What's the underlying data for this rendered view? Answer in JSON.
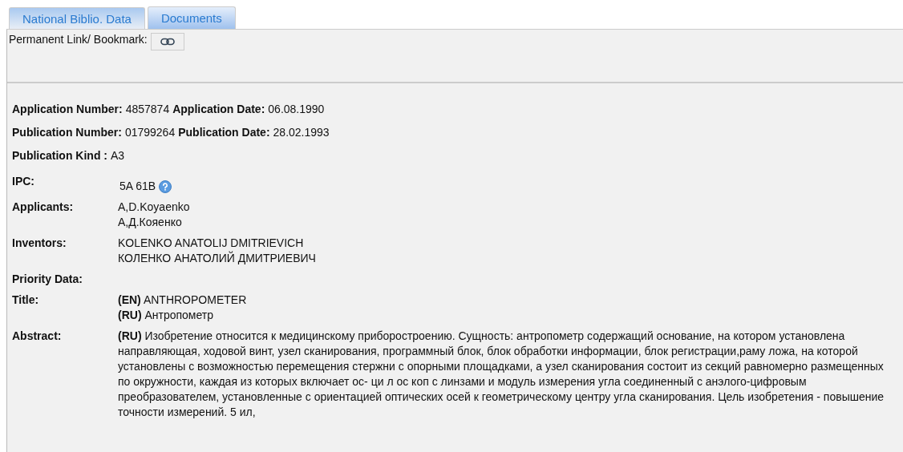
{
  "tabs": [
    {
      "label": "National Biblio. Data",
      "selected": true
    },
    {
      "label": "Documents",
      "selected": false
    }
  ],
  "permalink": {
    "label": "Permanent Link/ Bookmark:"
  },
  "summary": [
    {
      "pairs": [
        {
          "label": "Application Number:",
          "value": "4857874"
        },
        {
          "label": "Application Date:",
          "value": "06.08.1990"
        }
      ]
    },
    {
      "pairs": [
        {
          "label": "Publication Number:",
          "value": "01799264"
        },
        {
          "label": "Publication Date:",
          "value": "28.02.1993"
        }
      ]
    },
    {
      "pairs": [
        {
          "label": "Publication Kind :",
          "value": "A3"
        }
      ]
    }
  ],
  "fields": [
    {
      "label": "IPC:",
      "kind": "ipc",
      "values": [
        "5A 61B"
      ]
    },
    {
      "label": "Applicants:",
      "kind": "text",
      "values": [
        "A,D.Koyaenko",
        "А,Д.Кояенко"
      ]
    },
    {
      "label": "Inventors:",
      "kind": "text",
      "values": [
        "KOLENKO ANATOLIJ DMITRIEVICH",
        "КОЛЕНКО АНАТОЛИЙ ДМИТРИЕВИЧ"
      ]
    },
    {
      "label": "Priority Data:",
      "kind": "text"
    },
    {
      "label": "Title:",
      "kind": "text",
      "values": [
        "**(EN)** ANTHROPOMETER",
        "**(RU)** Антропометр"
      ]
    },
    {
      "label": "Abstract:",
      "kind": "text",
      "values": [
        "**(RU)** Изобретение относится к медицинскому приборостроению. Сущность: антропометр содержащий основание, на котором установлена направляющая, ходовой винт, узел сканирования, программный блок, блок обработки информации, блок регистрации,раму ложа, на которой установлены с возможностью перемещения стержни с опорными площадками, а узел сканирования состоит из секций равномерно размещенных по окружности, каждая из которых включает ос- ци л ос коп с линзами и модуль измерения угла соединенный с анэлого-цифровым преобразователем, установленные с ориентацией оптических осей к геометрическому центру угла сканирования. Цель изобретения - повышение точности измерений. 5 ил,"
      ]
    }
  ]
}
